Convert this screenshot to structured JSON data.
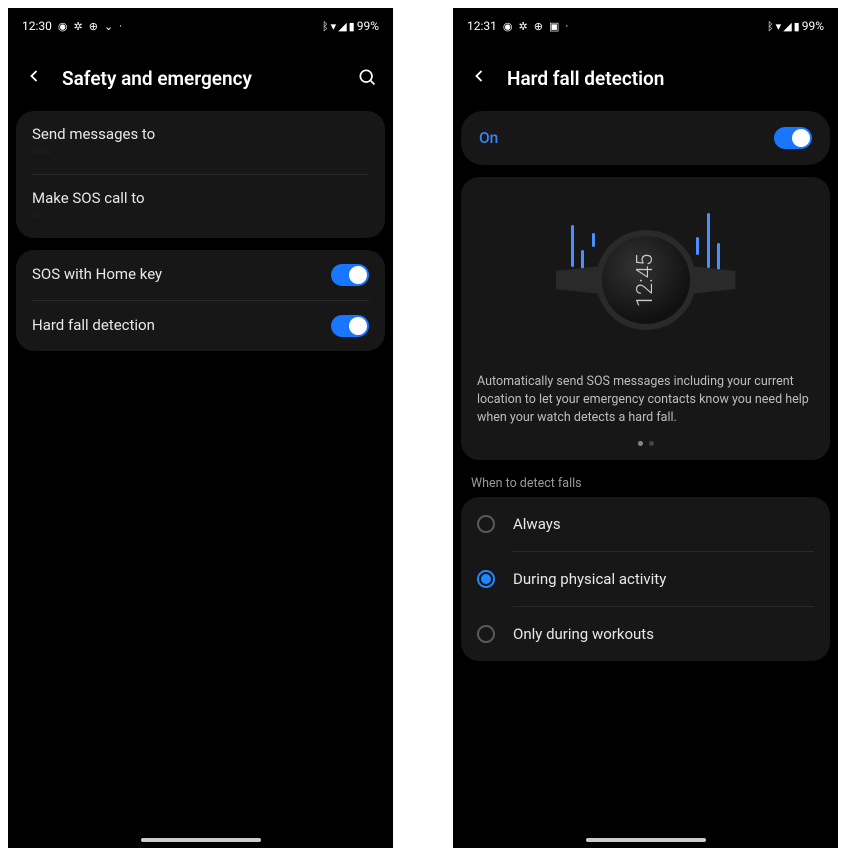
{
  "screen1": {
    "status": {
      "time": "12:30",
      "battery": "99%"
    },
    "title": "Safety and emergency",
    "send_messages": {
      "label": "Send messages to",
      "sub": "······"
    },
    "sos_call": {
      "label": "Make SOS call to",
      "sub": "···"
    },
    "sos_home": {
      "label": "SOS with Home key"
    },
    "fall": {
      "label": "Hard fall detection"
    }
  },
  "screen2": {
    "status": {
      "time": "12:31",
      "battery": "99%"
    },
    "title": "Hard fall detection",
    "master": "On",
    "watch_time": "12:45",
    "desc": "Automatically send SOS messages including your current location to let your emergency contacts know you need help when your watch detects a hard fall.",
    "subheader": "When to detect falls",
    "options": [
      {
        "label": "Always",
        "selected": false
      },
      {
        "label": "During physical activity",
        "selected": true
      },
      {
        "label": "Only during workouts",
        "selected": false
      }
    ]
  }
}
